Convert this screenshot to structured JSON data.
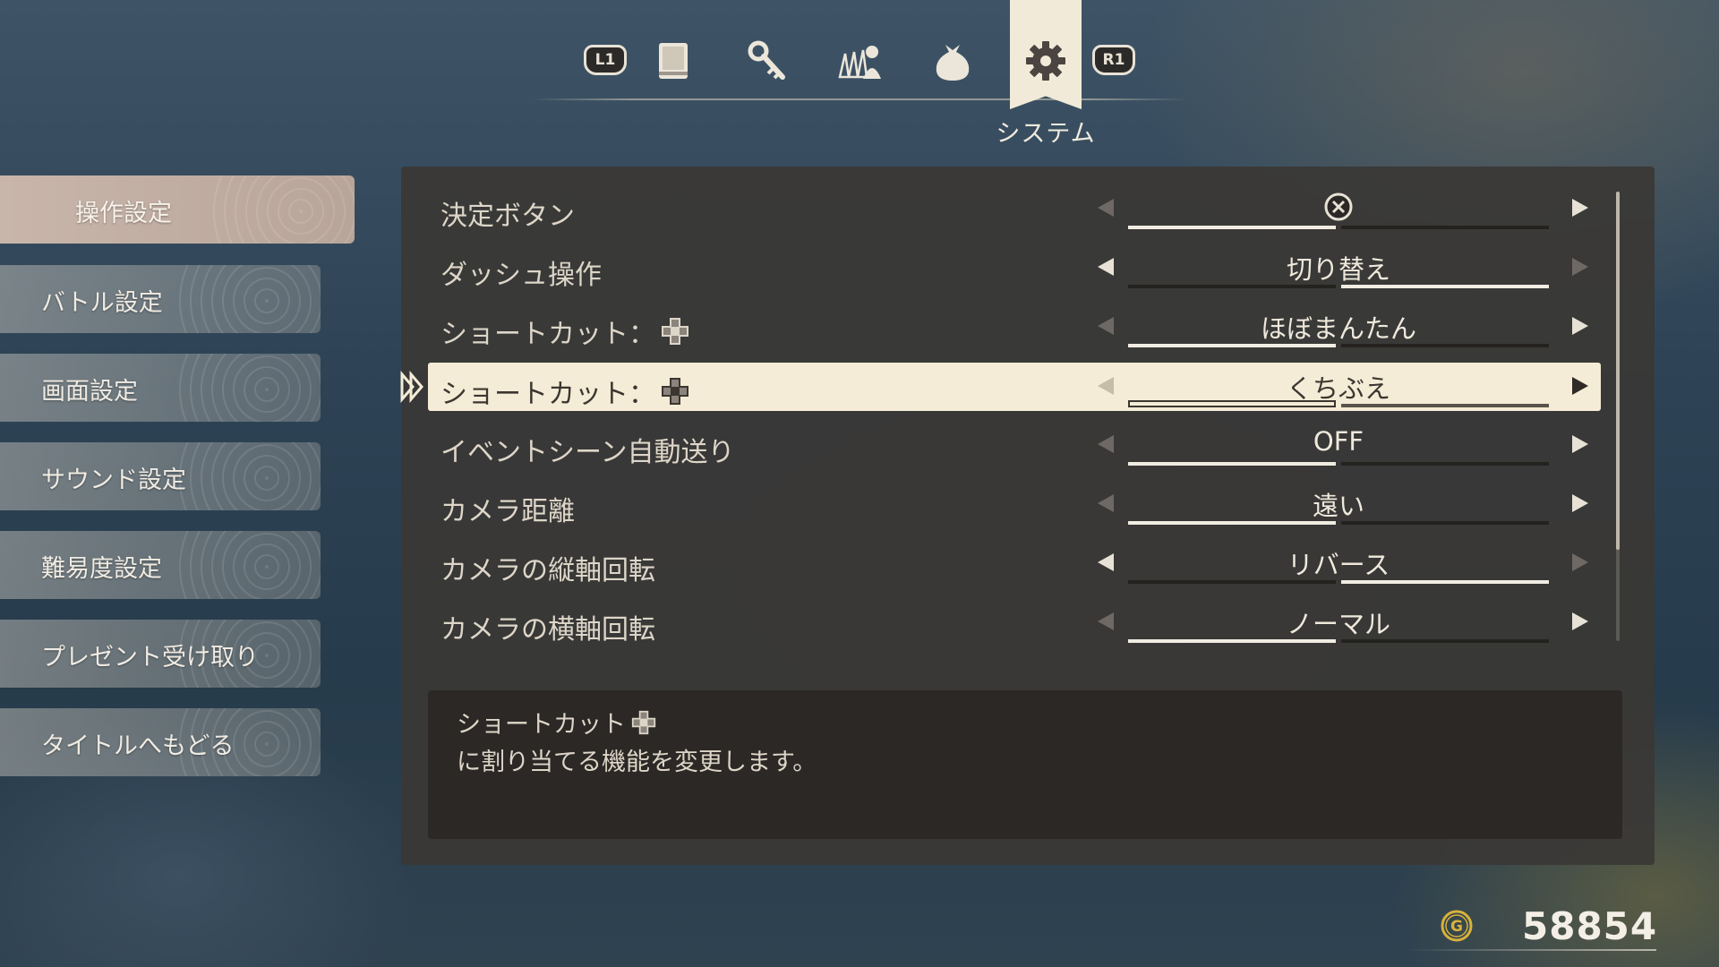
{
  "tabs": {
    "l1": "L1",
    "r1": "R1",
    "items": [
      {
        "icon": "book-icon"
      },
      {
        "icon": "key-icon"
      },
      {
        "icon": "party-icon"
      },
      {
        "icon": "bag-icon"
      },
      {
        "icon": "gear-icon"
      }
    ],
    "active_title": "システム"
  },
  "sidemenu": [
    {
      "label": "操作設定",
      "active": true
    },
    {
      "label": "バトル設定"
    },
    {
      "label": "画面設定"
    },
    {
      "label": "サウンド設定"
    },
    {
      "label": "難易度設定"
    },
    {
      "label": "プレゼント受け取り"
    },
    {
      "label": "タイトルへもどる"
    }
  ],
  "settings": [
    {
      "label": "決定ボタン",
      "value": "",
      "value_icon": "cross-button-icon"
    },
    {
      "label": "ダッシュ操作",
      "value": "切り替え"
    },
    {
      "label": "ショートカット：",
      "label_icon": "dpad-icon",
      "value": "ほぼまんたん"
    },
    {
      "label": "ショートカット：",
      "label_icon": "dpad-icon",
      "value": "くちぶえ",
      "selected": true
    },
    {
      "label": "イベントシーン自動送り",
      "value": "OFF"
    },
    {
      "label": "カメラ距離",
      "value": "遠い"
    },
    {
      "label": "カメラの縦軸回転",
      "value": "リバース"
    },
    {
      "label": "カメラの横軸回転",
      "value": "ノーマル"
    }
  ],
  "description": {
    "line1": "ショートカット",
    "line2": "に割り当てる機能を変更します。"
  },
  "gold": {
    "icon_letter": "G",
    "value": "58854"
  },
  "colors": {
    "accent": "#f2ead8",
    "panel": "#3a3836",
    "gold": "#d8b23a"
  }
}
